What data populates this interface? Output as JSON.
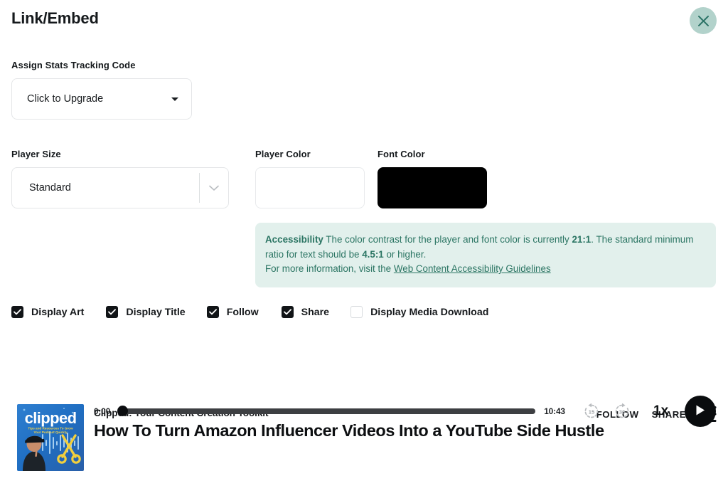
{
  "modal": {
    "title": "Link/Embed",
    "close_icon": "close-icon"
  },
  "stats": {
    "label": "Assign Stats Tracking Code",
    "value": "Click to Upgrade",
    "caret_icon": "caret-down-icon"
  },
  "player_size": {
    "label": "Player Size",
    "value": "Standard",
    "chevron_icon": "chevron-down-icon"
  },
  "player_color": {
    "label": "Player Color",
    "value": "#ffffff"
  },
  "font_color": {
    "label": "Font Color",
    "value": "#000000"
  },
  "accessibility": {
    "heading": "Accessibility",
    "line1_a": " The color contrast for the player and font color is currently ",
    "ratio_current": "21:1",
    "line1_b": ". The standard",
    "line2_a": "minimum ratio for text should be ",
    "ratio_min": "4.5:1",
    "line2_b": " or higher.",
    "line3": "For more information, visit the ",
    "link_text": "Web Content Accessibility Guidelines",
    "bg_color": "#e2f0ec",
    "text_color": "#2b7563"
  },
  "toggles": [
    {
      "label": "Display Art",
      "checked": true
    },
    {
      "label": "Display Title",
      "checked": true
    },
    {
      "label": "Follow",
      "checked": true
    },
    {
      "label": "Share",
      "checked": true
    },
    {
      "label": "Display Media Download",
      "checked": false
    }
  ],
  "player": {
    "artwork_alt": "clipped",
    "artwork_word": "clipped",
    "artwork_tagline1": "Tips and Resources To Grow",
    "artwork_tagline2": "Your Podcast Quickly",
    "show_name": "Clipped: Your Content Creation Toolkit",
    "episode_title": "How To Turn Amazon Influencer Videos Into a YouTube Side Hustle",
    "follow_label": "FOLLOW",
    "share_label": "SHARE",
    "brand_icon": "brand-logo-icon",
    "current_time": "0:00",
    "duration": "10:43",
    "progress_percent": 0,
    "rewind_label": "15",
    "forward_label": "30",
    "rewind_icon": "rewind-15-icon",
    "forward_icon": "forward-30-icon",
    "speed_label": "1x",
    "play_icon": "play-icon"
  }
}
